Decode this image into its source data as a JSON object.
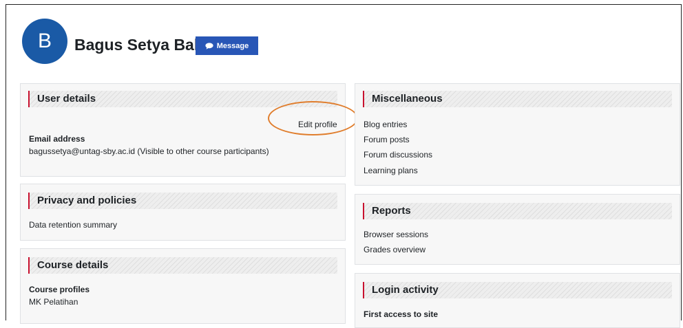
{
  "profile": {
    "initial": "B",
    "name": "Bagus Setya Bakti",
    "message_label": "Message"
  },
  "user_details": {
    "title": "User details",
    "edit_profile": "Edit profile",
    "email_label": "Email address",
    "email_value": "bagussetya@untag-sby.ac.id (Visible to other course participants)"
  },
  "privacy": {
    "title": "Privacy and policies",
    "items": [
      "Data retention summary"
    ]
  },
  "course_details": {
    "title": "Course details",
    "profiles_label": "Course profiles",
    "profiles": [
      "MK Pelatihan"
    ]
  },
  "misc": {
    "title": "Miscellaneous",
    "items": [
      "Blog entries",
      "Forum posts",
      "Forum discussions",
      "Learning plans"
    ]
  },
  "reports": {
    "title": "Reports",
    "items": [
      "Browser sessions",
      "Grades overview"
    ]
  },
  "login_activity": {
    "title": "Login activity",
    "first_access_label": "First access to site"
  },
  "colors": {
    "accent_red": "#c8102e",
    "button_blue": "#2856b6",
    "avatar_blue": "#1a5aa6",
    "highlight_orange": "#e07d2c"
  }
}
